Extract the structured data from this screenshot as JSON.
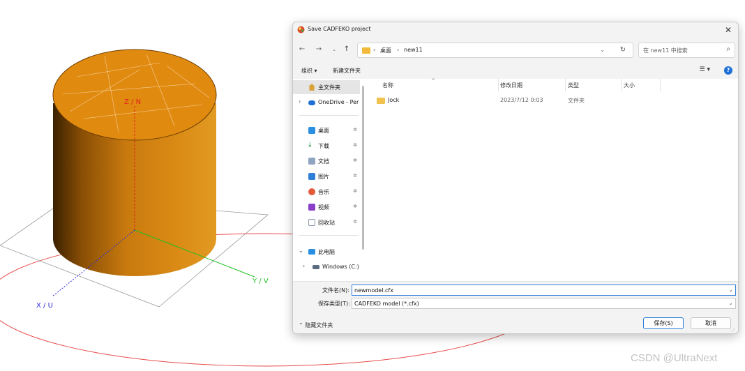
{
  "viewport": {
    "axes": {
      "z_label": "Z / N",
      "y_label": "Y / V",
      "x_label": "X / U"
    },
    "colors": {
      "cylinder": "#e18a10",
      "z_axis": "#e02020",
      "y_axis": "#1fbf1f",
      "x_axis": "#2b2bd6",
      "ground_arc": "#e84a4a"
    }
  },
  "dialog": {
    "title": "Save CADFEKO project",
    "app_icon": "cadfeko-app-icon",
    "address": {
      "crumbs": [
        "桌面",
        "new11"
      ]
    },
    "search": {
      "placeholder": "在 new11 中搜索"
    },
    "toolbar": {
      "organize": "组织 ▾",
      "new_folder": "新建文件夹"
    },
    "sidebar": {
      "items": [
        {
          "label": "主文件夹",
          "icon": "home-icon",
          "pinned": false
        },
        {
          "label": "OneDrive - Per",
          "icon": "cloud-icon",
          "pinned": false
        },
        {
          "label": "桌面",
          "icon": "desktop-icon",
          "pinned": true
        },
        {
          "label": "下载",
          "icon": "download-icon",
          "pinned": true
        },
        {
          "label": "文档",
          "icon": "document-icon",
          "pinned": true
        },
        {
          "label": "图片",
          "icon": "pictures-icon",
          "pinned": true
        },
        {
          "label": "音乐",
          "icon": "music-icon",
          "pinned": true
        },
        {
          "label": "视频",
          "icon": "video-icon",
          "pinned": true
        },
        {
          "label": "回收站",
          "icon": "recycle-bin-icon",
          "pinned": true
        },
        {
          "label": "此电脑",
          "icon": "computer-icon",
          "pinned": false
        },
        {
          "label": "Windows (C:)",
          "icon": "drive-icon",
          "pinned": false
        }
      ]
    },
    "columns": [
      "名称",
      "修改日期",
      "类型",
      "大小"
    ],
    "files": [
      {
        "name": "Jock",
        "modified": "2023/7/12 0:03",
        "type": "文件夹",
        "size": ""
      }
    ],
    "filename": {
      "label": "文件名(N):",
      "value": "newmodel.cfx"
    },
    "filetype": {
      "label": "保存类型(T):",
      "value": "CADFEKO model (*.cfx)"
    },
    "hide_folders": "隐藏文件夹",
    "buttons": {
      "save": "保存(S)",
      "cancel": "取消"
    },
    "accent": "#2f7fd9"
  },
  "watermark": "CSDN @UltraNext"
}
